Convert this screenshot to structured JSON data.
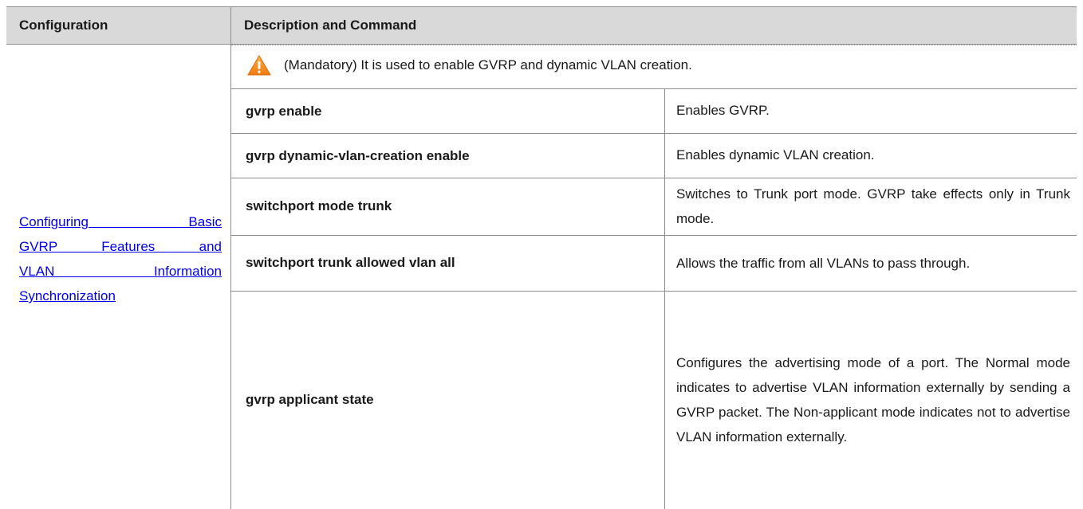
{
  "table": {
    "header": {
      "col1": "Configuration",
      "col2": "Description and Command"
    },
    "config_link": {
      "lines": [
        "Configuring Basic",
        "GVRP Features and",
        "VLAN Information",
        "Synchronization"
      ]
    },
    "note": {
      "icon": "warning-icon",
      "text": "(Mandatory) It is used to enable GVRP and dynamic VLAN creation."
    },
    "rows": [
      {
        "command": "gvrp enable",
        "description": "Enables GVRP."
      },
      {
        "command": "gvrp dynamic-vlan-creation enable",
        "description": "Enables dynamic VLAN creation."
      },
      {
        "command": "switchport mode trunk",
        "description": "Switches to Trunk port mode. GVRP take effects only in Trunk mode."
      },
      {
        "command": "switchport trunk allowed vlan all",
        "description": "Allows the traffic from all VLANs to pass through."
      },
      {
        "command": "gvrp applicant state",
        "description": "Configures the advertising mode of a port. The Normal mode indicates to advertise VLAN information externally by sending a GVRP packet. The Non-applicant mode indicates not to advertise VLAN information externally."
      }
    ]
  }
}
